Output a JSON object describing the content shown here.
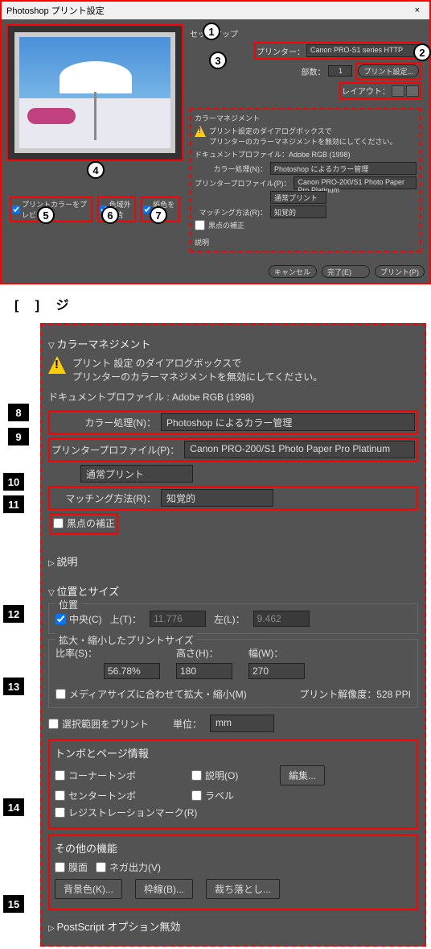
{
  "dialog": {
    "title": "Photoshop プリント設定",
    "close": "×"
  },
  "setup": {
    "header": "セットアップ",
    "printer_lbl": "プリンター：",
    "printer_val": "Canon PRO-S1 series HTTP",
    "copies_lbl": "部数：",
    "copies_val": "1",
    "print_settings_btn": "プリント設定...",
    "layout_lbl": "レイアウト："
  },
  "preview": {
    "cb1": "プリントカラーをプレビュー",
    "cb2": "色域外警告",
    "cb3": "紙色を表示"
  },
  "cm_small": {
    "header": "カラーマネジメント",
    "warn1": "プリント設定のダイアログボックスで",
    "warn2": "プリンターのカラーマネジメントを無効にしてください。",
    "docprof_lbl": "ドキュメントプロファイル：",
    "docprof_val": "Adobe RGB (1998)",
    "handling_lbl": "カラー処理(N)：",
    "handling_val": "Photoshop によるカラー管理",
    "pprof_lbl": "プリンタープロファイル(P)：",
    "pprof_val": "Canon PRO-200/S1 Photo Paper Pro Platinum",
    "mode_val": "通常プリント",
    "match_lbl": "マッチング方法(R)：",
    "match_val": "知覚的",
    "bpc": "黒点の補正",
    "desc": "説明"
  },
  "footer": {
    "cancel": "キャンセル",
    "done": "完了(E)",
    "print": "プリント(P)"
  },
  "midcap": "[                        ]    ジ",
  "detail": {
    "cm_title": "カラーマネジメント",
    "warn1": "プリント 設定 のダイアログボックスで",
    "warn2": "プリンターのカラーマネジメントを無効にしてください。",
    "docprof_full": "ドキュメントプロファイル : Adobe RGB (1998)",
    "handling_lbl": "カラー処理(N)：",
    "handling_val": "Photoshop によるカラー管理",
    "pprof_lbl": "プリンタープロファイル(P)：",
    "pprof_val": "Canon PRO-200/S1 Photo Paper Pro Platinum",
    "mode_val": "通常プリント",
    "match_lbl": "マッチング方法(R)：",
    "match_val": "知覚的",
    "bpc": "黒点の補正",
    "desc": "説明",
    "pos_size": "位置とサイズ",
    "position_grp": "位置",
    "center": "中央(C)",
    "top_lbl": "上(T)：",
    "top_val": "11.776",
    "left_lbl": "左(L)：",
    "left_val": "9.462",
    "scale_grp": "拡大・縮小したプリントサイズ",
    "scale_lbl": "比率(S)：",
    "scale_val": "56.78%",
    "height_lbl": "高さ(H)：",
    "height_val": "180",
    "width_lbl": "幅(W)：",
    "width_val": "270",
    "fit_media": "メディアサイズに合わせて拡大・縮小(M)",
    "ppi_lbl": "プリント解像度：528 PPI",
    "sel_print": "選択範囲をプリント",
    "unit_lbl": "単位：",
    "unit_val": "mm",
    "marks_title": "トンボとページ情報",
    "corner": "コーナートンボ",
    "desc_o": "説明(O)",
    "edit_btn": "編集...",
    "center_m": "センタートンボ",
    "label_m": "ラベル",
    "reg": "レジストレーションマーク(R)",
    "other_title": "その他の機能",
    "emulsion": "膜面",
    "neg": "ネガ出力(V)",
    "bg_btn": "背景色(K)...",
    "border_btn": "枠線(B)...",
    "bleed_btn": "裁ち落とし...",
    "ps_title": "PostScript オプション無効"
  },
  "callouts": {
    "c1": "1",
    "c2": "2",
    "c3": "3",
    "c4": "4",
    "c5": "5",
    "c6": "6",
    "c7": "7",
    "c8": "8",
    "c9": "9",
    "c10": "10",
    "c11": "11",
    "c12": "12",
    "c13": "13",
    "c14": "14",
    "c15": "15"
  }
}
